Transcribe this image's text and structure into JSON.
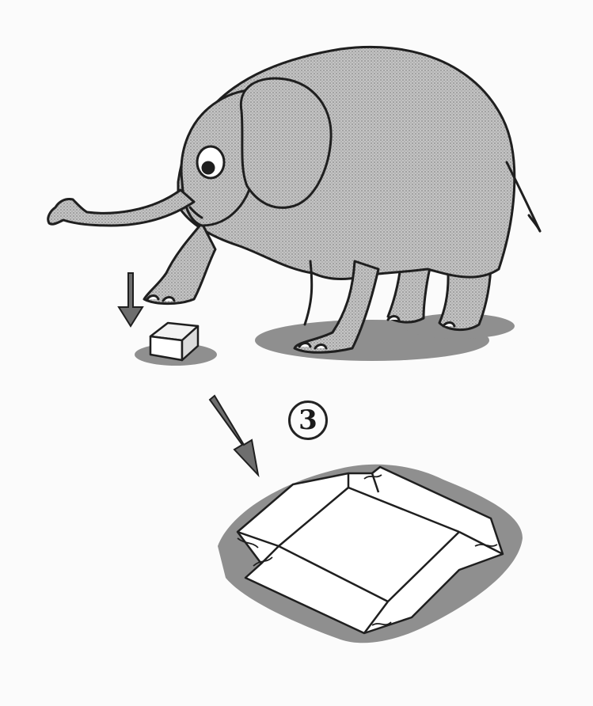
{
  "illustration": {
    "step_number": "3",
    "colors": {
      "ink": "#1f1f1f",
      "elephant_fill": "#bdbdbd",
      "shadow": "#8f8f8f",
      "arrow": "#6e6e6e",
      "paper": "#ffffff"
    },
    "icons": [
      "elephant",
      "sugar-cube",
      "down-arrow",
      "flattened-box-net"
    ]
  }
}
